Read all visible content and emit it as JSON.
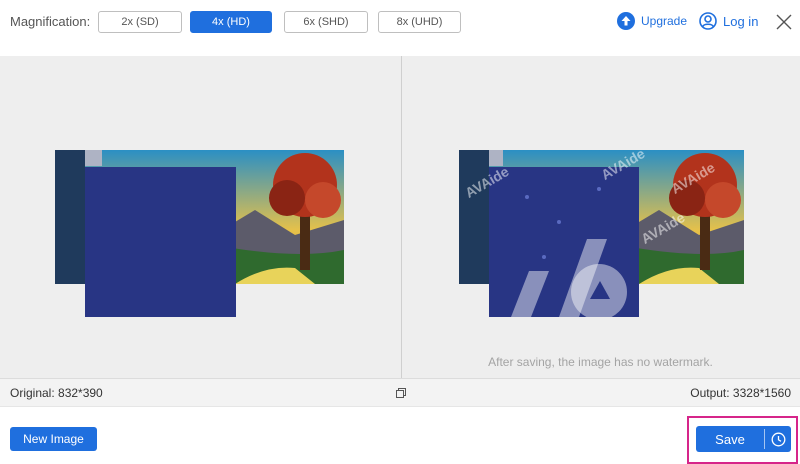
{
  "toolbar": {
    "magnification_label": "Magnification:",
    "options": [
      {
        "label": "2x (SD)",
        "active": false
      },
      {
        "label": "4x (HD)",
        "active": true
      },
      {
        "label": "6x (SHD)",
        "active": false
      },
      {
        "label": "8x (UHD)",
        "active": false
      }
    ],
    "upgrade_label": "Upgrade",
    "login_label": "Log in"
  },
  "preview": {
    "watermark_note": "After saving, the image has no watermark.",
    "watermark_text": "AVAide"
  },
  "info": {
    "original": "Original: 832*390",
    "output": "Output: 3328*1560"
  },
  "actions": {
    "new_image_label": "New Image",
    "save_label": "Save"
  },
  "colors": {
    "accent": "#1f6fde",
    "highlight_frame": "#d6258a",
    "overlay": "#283584"
  }
}
